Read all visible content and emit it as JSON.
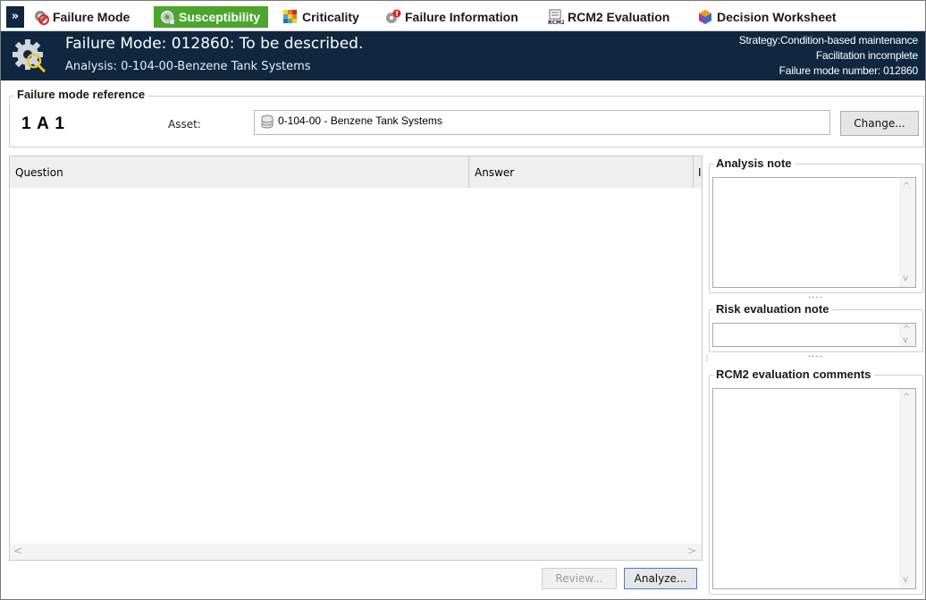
{
  "tabs": [
    {
      "label": "Failure Mode",
      "icon": "failure-mode-icon",
      "active": false
    },
    {
      "label": "Susceptibility",
      "icon": "susceptibility-icon",
      "active": true
    },
    {
      "label": "Criticality",
      "icon": "criticality-icon",
      "active": false
    },
    {
      "label": "Failure Information",
      "icon": "failure-information-icon",
      "active": false
    },
    {
      "label": "RCM2 Evaluation",
      "icon": "rcm2-icon",
      "active": false
    },
    {
      "label": "Decision Worksheet",
      "icon": "decision-worksheet-icon",
      "active": false
    }
  ],
  "collapse_glyph": "»",
  "header": {
    "title": "Failure Mode: 012860: To be described.",
    "subtitle": "Analysis: 0-104-00-Benzene Tank Systems",
    "strategy": "Strategy:Condition-based maintenance",
    "facilitation": "Facilitation incomplete",
    "failure_mode_number": "Failure mode number: 012860"
  },
  "reference": {
    "legend": "Failure mode reference",
    "id": "1 A 1",
    "asset_label": "Asset:",
    "asset_value": "0-104-00 - Benzene Tank Systems",
    "change_label": "Change..."
  },
  "grid": {
    "col_question": "Question",
    "col_answer": "Answer",
    "col_more": "I",
    "scroll_left": "<",
    "scroll_right": ">"
  },
  "actions": {
    "review_label": "Review...",
    "analyze_label": "Analyze..."
  },
  "notes": {
    "analysis_note": "Analysis note",
    "risk_evaluation_note": "Risk evaluation note",
    "rcm2_comments": "RCM2 evaluation comments",
    "scroll_up": "^",
    "scroll_down": "v",
    "splitter": "....",
    "vsplitter": "⋮"
  },
  "colors": {
    "banner": "#0f2840",
    "active_tab": "#4ca62c"
  }
}
